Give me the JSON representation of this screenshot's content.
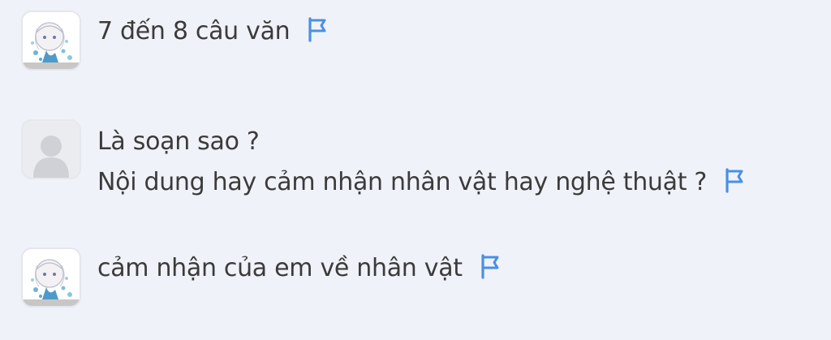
{
  "comments": [
    {
      "avatar": "anime-girl-avatar",
      "lines": [
        "7 đến 8 câu văn"
      ],
      "action_icon": "report-flag-icon"
    },
    {
      "avatar": "default-user-avatar",
      "lines": [
        "Là soạn sao ?",
        "Nội dung hay cảm nhận nhân vật hay nghệ thuật ?"
      ],
      "action_icon": "report-flag-icon"
    },
    {
      "avatar": "anime-girl-avatar",
      "lines": [
        "cảm nhận của em về nhân vật"
      ],
      "action_icon": "report-flag-icon"
    }
  ],
  "colors": {
    "background": "#f0f2f9",
    "text": "#3b3b3b",
    "flag": "#4a90e2"
  }
}
